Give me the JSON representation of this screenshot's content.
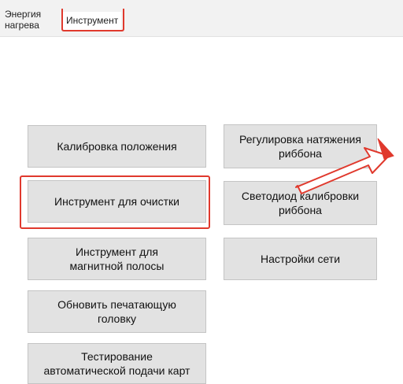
{
  "tabs": {
    "energy_label": "Энергия\nнагрева",
    "tool_label": "Инструмент"
  },
  "buttons": {
    "position_calibration": "Калибровка положения",
    "cleaning_tool": "Инструмент для очистки",
    "magnetic_stripe_tool": "Инструмент для\nмагнитной полосы",
    "update_printhead": "Обновить печатающую\nголовку",
    "card_feed_test": "Тестирование\nавтоматической подачи карт",
    "ribbon_tension": "Регулировка натяжения\nриббона",
    "ribbon_led_calibration": "Светодиод калибровки\nриббона",
    "network_settings": "Настройки сети"
  },
  "colors": {
    "highlight": "#e0392d",
    "button_bg": "#e2e2e2",
    "tabbar_bg": "#f2f2f2"
  }
}
